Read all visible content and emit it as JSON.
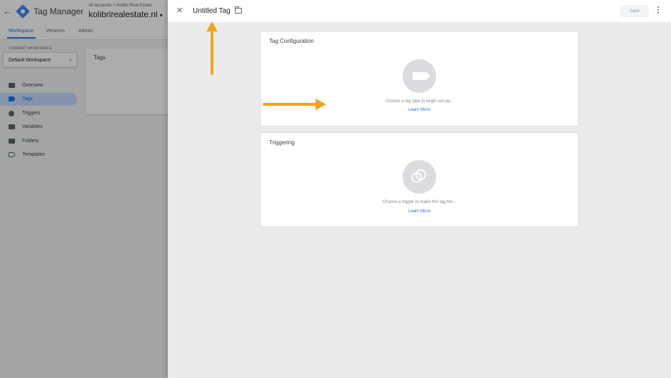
{
  "app": {
    "name": "Tag Manager",
    "breadcrumb": "All accounts > Kolibri Real Estate",
    "container": "kolibrirealestate.nl"
  },
  "top_tabs": [
    {
      "label": "Workspace",
      "active": true
    },
    {
      "label": "Versions"
    },
    {
      "label": "Admin"
    }
  ],
  "workspace": {
    "section_label": "CURRENT WORKSPACE",
    "name": "Default Workspace"
  },
  "nav": [
    {
      "label": "Overview",
      "icon": "overview-icon"
    },
    {
      "label": "Tags",
      "icon": "tag-icon",
      "active": true
    },
    {
      "label": "Triggers",
      "icon": "trigger-icon"
    },
    {
      "label": "Variables",
      "icon": "variables-icon"
    },
    {
      "label": "Folders",
      "icon": "folder-icon"
    },
    {
      "label": "Templates",
      "icon": "template-icon"
    }
  ],
  "tags_card": {
    "title": "Tags"
  },
  "editor": {
    "tag_name": "Untitled Tag",
    "save_label": "Save",
    "tag_configuration": {
      "title": "Tag Configuration",
      "hint": "Choose a tag type to begin set-up...",
      "link": "Learn More"
    },
    "triggering": {
      "title": "Triggering",
      "hint": "Choose a trigger to make this tag fire...",
      "link": "Learn More"
    }
  },
  "colors": {
    "accent": "#1a73e8",
    "annotation_arrow": "#f0a51e",
    "placeholder": "#dadce0"
  }
}
